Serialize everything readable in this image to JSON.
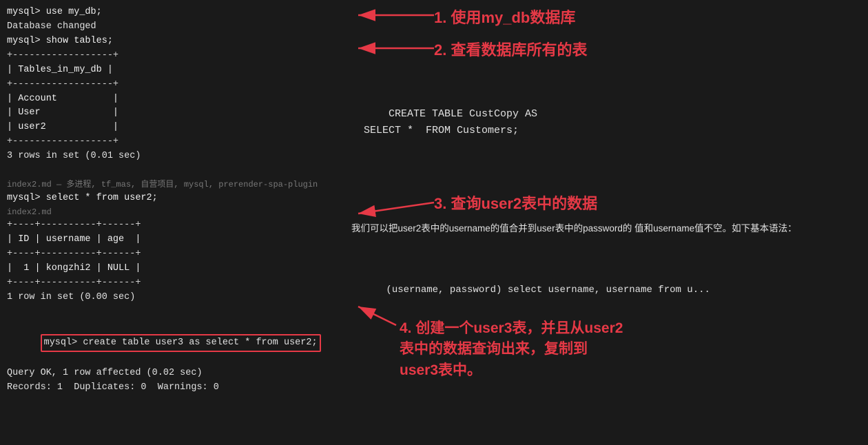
{
  "terminal": {
    "lines": [
      {
        "text": "mysql> use my_db;",
        "type": "prompt"
      },
      {
        "text": "Database changed",
        "type": "output"
      },
      {
        "text": "mysql> show tables;",
        "type": "prompt"
      },
      {
        "text": "+------------------+",
        "type": "border"
      },
      {
        "text": "| Tables_in_my_db |",
        "type": "content"
      },
      {
        "text": "+------------------+",
        "type": "border"
      },
      {
        "text": "| Account          |",
        "type": "content"
      },
      {
        "text": "| User             |",
        "type": "content"
      },
      {
        "text": "| user2            |",
        "type": "content"
      },
      {
        "text": "+------------------+",
        "type": "border"
      },
      {
        "text": "3 rows in set (0.01 sec)",
        "type": "output"
      },
      {
        "text": "",
        "type": "empty"
      },
      {
        "text": "mysql> select * from user2;",
        "type": "prompt"
      },
      {
        "text": "+----+----------+------+",
        "type": "border"
      },
      {
        "text": "| ID | username | age  |",
        "type": "content"
      },
      {
        "text": "+----+----------+------+",
        "type": "border"
      },
      {
        "text": "|  1 | kongzhi2 | NULL |",
        "type": "content"
      },
      {
        "text": "+----+----------+------+",
        "type": "border"
      },
      {
        "text": "1 row in set (0.00 sec)",
        "type": "output"
      },
      {
        "text": "",
        "type": "empty"
      },
      {
        "text": "mysql> create table user3 as select * from user2;",
        "type": "prompt",
        "highlight": true
      },
      {
        "text": "Query OK, 1 row affected (0.02 sec)",
        "type": "output"
      },
      {
        "text": "Records: 1  Duplicates: 0  Warnings: 0",
        "type": "output"
      }
    ]
  },
  "annotations": {
    "ann1": "1. 使用my_db数据库",
    "ann2": "2. 查看数据库所有的表",
    "ann3": "3. 查询user2表中的数据",
    "ann4_line1": "4. 创建一个user3表，并且从user2",
    "ann4_line2": "表中的数据查询出来，复制到",
    "ann4_line3": "user3表中。"
  },
  "overlays": {
    "create_table": "CREATE TABLE CustCopy AS\n  SELECT *  FROM Customers;",
    "filepath": "index2.md — 多进程, tf_mas, 自营项目, mysql, prerender-spa-plugin",
    "filepath2": "index2.md",
    "desc_text": "我们可以把user2表中的username的值合并到user表中的password的\n值和username值不空。如下基本语法：",
    "sql_partial": "(username, password) select username, username from u..."
  },
  "colors": {
    "bg": "#1a1a1a",
    "text": "#e0e0e0",
    "accent": "#e63946",
    "dim": "#888888"
  }
}
